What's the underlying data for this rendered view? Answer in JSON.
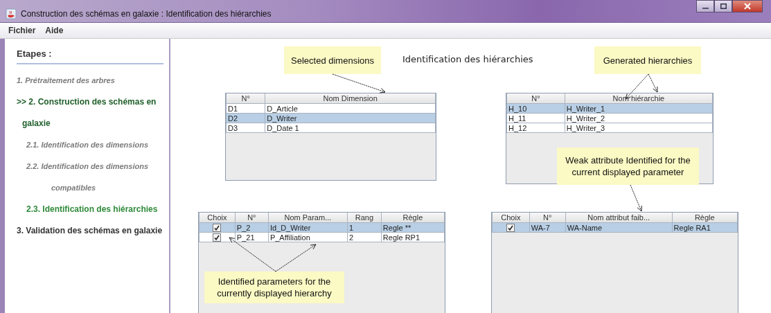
{
  "window": {
    "title": "Construction des schémas en galaxie : Identification des hiérarchies"
  },
  "menu": [
    {
      "label": "Fichier"
    },
    {
      "label": "Aide"
    }
  ],
  "sidebar": {
    "heading": "Etapes :",
    "steps": [
      {
        "label": "1. Prétraitement des arbres",
        "selected": false,
        "completed": true
      },
      {
        "label": ">> 2. Construction des schémas en galaxie",
        "selected": true,
        "completed": false,
        "children": [
          {
            "label": "2.1. Identification des dimensions",
            "selected": false,
            "completed": true
          },
          {
            "label": "2.2. Identification des dimensions compatibles",
            "selected": false,
            "completed": true
          },
          {
            "label": "2.3. Identification des hiérarchies",
            "selected": true,
            "completed": false
          }
        ]
      },
      {
        "label": "3. Validation des schémas en galaxie",
        "selected": false,
        "completed": false
      }
    ]
  },
  "main": {
    "title": "Identification des hiérarchies",
    "tables": [
      {
        "columns": [
          {
            "label": "N°",
            "kind": "text"
          },
          {
            "label": "Nom Dimension",
            "kind": "text"
          }
        ],
        "rows": [
          {
            "selected": false,
            "cells": [
              "D1",
              "D_Article"
            ]
          },
          {
            "selected": true,
            "cells": [
              "D2",
              "D_Writer"
            ]
          },
          {
            "selected": false,
            "cells": [
              "D3",
              "D_Date 1"
            ]
          }
        ]
      },
      {
        "columns": [
          {
            "label": "N°",
            "kind": "text"
          },
          {
            "label": "Nom hiérarchie",
            "kind": "text"
          }
        ],
        "rows": [
          {
            "selected": true,
            "cells": [
              "H_10",
              "H_Writer_1"
            ]
          },
          {
            "selected": false,
            "cells": [
              "H_11",
              "H_Writer_2"
            ]
          },
          {
            "selected": false,
            "cells": [
              "H_12",
              "H_Writer_3"
            ]
          }
        ]
      },
      {
        "columns": [
          {
            "label": "Choix",
            "kind": "check"
          },
          {
            "label": "N°",
            "kind": "text"
          },
          {
            "label": "Nom Param...",
            "kind": "text"
          },
          {
            "label": "Rang",
            "kind": "text"
          },
          {
            "label": "Règle",
            "kind": "text"
          }
        ],
        "rows": [
          {
            "selected": true,
            "cells": [
              {
                "checked": true
              },
              "P_2",
              "Id_D_Writer",
              "1",
              "Regle **"
            ]
          },
          {
            "selected": false,
            "cells": [
              {
                "checked": true
              },
              "P_21",
              "P_Affiliation",
              "2",
              "Regle RP1"
            ]
          }
        ]
      },
      {
        "columns": [
          {
            "label": "Choix",
            "kind": "check"
          },
          {
            "label": "N°",
            "kind": "text"
          },
          {
            "label": "Nom attribut faib...",
            "kind": "text"
          },
          {
            "label": "Règle",
            "kind": "text"
          }
        ],
        "rows": [
          {
            "selected": true,
            "cells": [
              {
                "checked": true
              },
              "WA-7",
              "WA-Name",
              "Regle RA1"
            ]
          }
        ]
      }
    ],
    "callouts": [
      {
        "text": "Selected dimensions"
      },
      {
        "text": "Generated hierarchies"
      },
      {
        "text": "Weak attribute Identified for the current displayed parameter"
      },
      {
        "text": "Identified parameters for the currently displayed hierarchy"
      }
    ]
  }
}
